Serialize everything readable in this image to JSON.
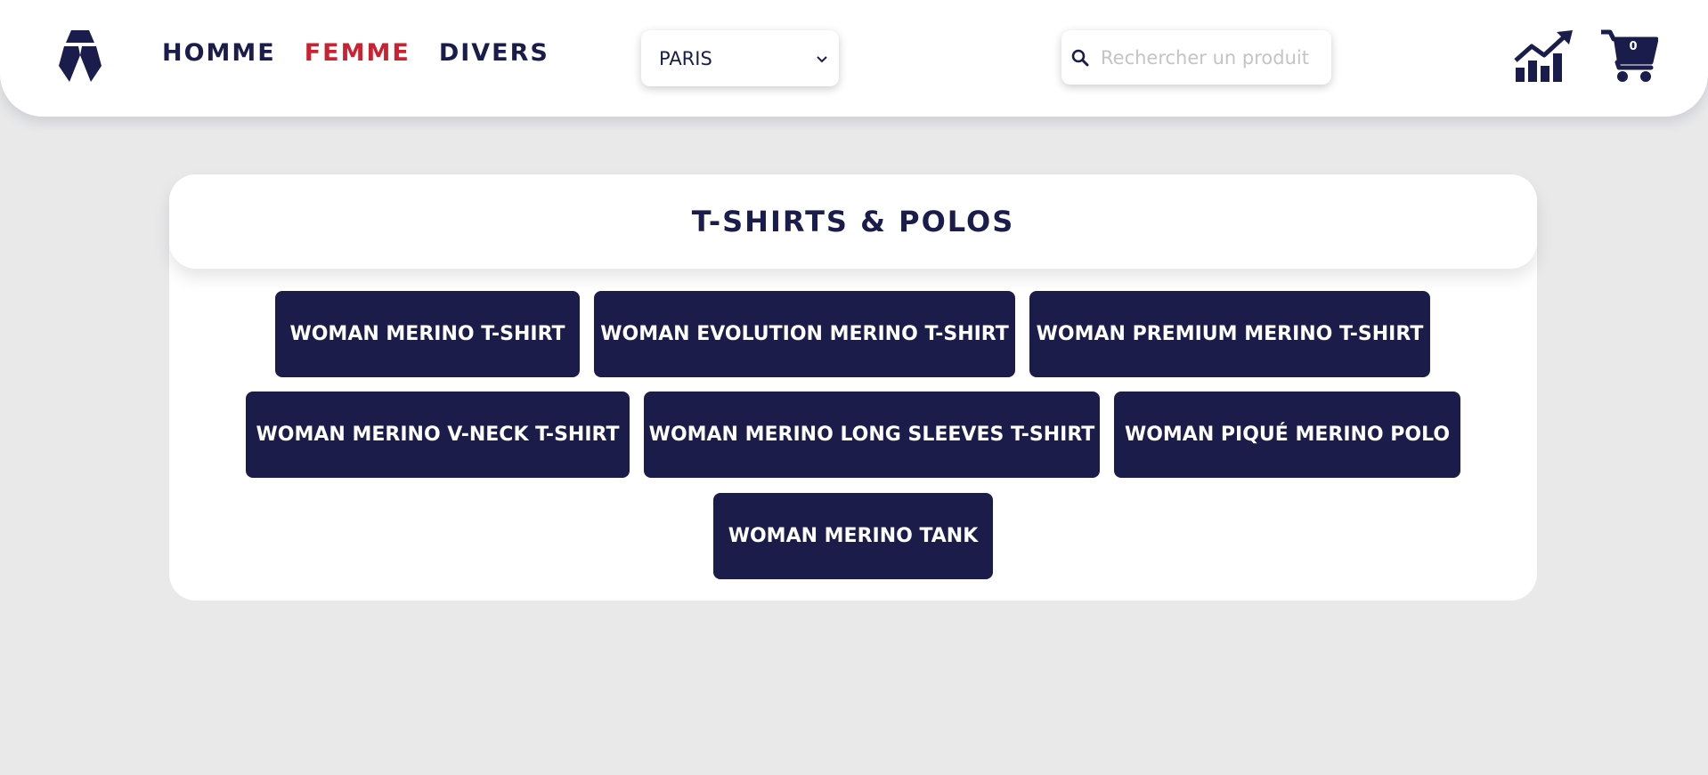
{
  "nav": {
    "items": [
      {
        "label": "HOMME"
      },
      {
        "label": "FEMME"
      },
      {
        "label": "DIVERS"
      }
    ]
  },
  "city_select": {
    "value": "PARIS"
  },
  "search": {
    "placeholder": "Rechercher un produit",
    "value": ""
  },
  "cart": {
    "count": "0"
  },
  "category": {
    "title": "T-SHIRTS & POLOS",
    "products": [
      {
        "label": "WOMAN MERINO T-SHIRT"
      },
      {
        "label": "WOMAN EVOLUTION MERINO T-SHIRT"
      },
      {
        "label": "WOMAN PREMIUM MERINO T-SHIRT"
      },
      {
        "label": "WOMAN MERINO V-NECK T-SHIRT"
      },
      {
        "label": "WOMAN MERINO LONG SLEEVES T-SHIRT"
      },
      {
        "label": "WOMAN PIQUÉ MERINO POLO"
      },
      {
        "label": "WOMAN MERINO TANK"
      }
    ]
  },
  "colors": {
    "navy": "#1a1c4b",
    "accent_red": "#cc2131",
    "background": "#e9e9ea"
  },
  "icons": [
    "logo-icon",
    "chevron-down-icon",
    "search-icon",
    "stats-chart-icon",
    "cart-icon"
  ]
}
